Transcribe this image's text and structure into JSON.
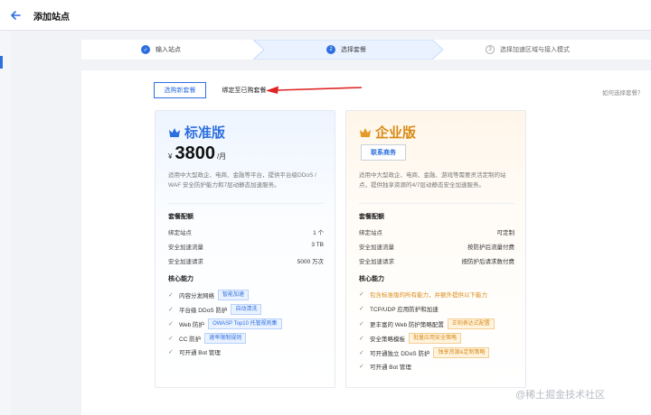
{
  "header": {
    "title": "添加站点"
  },
  "steps": [
    {
      "num": "✓",
      "label": "输入站点"
    },
    {
      "num": "2",
      "label": "选择套餐"
    },
    {
      "num": "3",
      "label": "选择加速区域与接入模式"
    }
  ],
  "tabs": {
    "new": "选购新套餐",
    "bind": "绑定至已购套餐"
  },
  "help_link": "如何选择套餐？",
  "plans": {
    "standard": {
      "name": "标准版",
      "currency": "¥",
      "price": "3800",
      "unit": "/月",
      "desc": "适用中大型政企、电商、金融等平台，提供平台级DDoS / WAF 安全防护能力和7层动静态加速服务。",
      "config_title": "套餐配额",
      "config": [
        {
          "k": "绑定站点",
          "v": "1 个"
        },
        {
          "k": "安全加速流量",
          "v": "3 TB"
        },
        {
          "k": "安全加速请求",
          "v": "5000 万次"
        }
      ],
      "cap_title": "核心能力",
      "caps": [
        {
          "text": "内容分发网络",
          "tag": "智能加速"
        },
        {
          "text": "平台级 DDoS 防护",
          "tag": "自动清洗"
        },
        {
          "text": "Web 防护",
          "tag": "OWASP Top10 托管规则集"
        },
        {
          "text": "CC 防护",
          "tag": "速率限制规则"
        },
        {
          "text": "可开通 Bot 管理",
          "tag": ""
        }
      ]
    },
    "enterprise": {
      "name": "企业版",
      "contact": "联系商务",
      "desc": "适用中大型政企、电商、金融、游戏等需要灵活定制的站点，提供独享资源的4/7层动静态安全加速服务。",
      "config_title": "套餐配额",
      "config": [
        {
          "k": "绑定站点",
          "v": "可定制"
        },
        {
          "k": "安全加速流量",
          "v": "按防护后流量付费"
        },
        {
          "k": "安全加速请求",
          "v": "按防护后请求数付费"
        }
      ],
      "cap_title": "核心能力",
      "caps": [
        {
          "text": "包含标准版的所有能力，并额外提供以下能力",
          "tag": ""
        },
        {
          "text": "TCP/UDP 应用防护和加速",
          "tag": ""
        },
        {
          "text": "更丰富的 Web 防护策略配置",
          "tag": "正则表达式配置"
        },
        {
          "text": "安全策略模板",
          "tag": "批量应用安全策略"
        },
        {
          "text": "可开通独立 DDoS 防护",
          "tag": "独享资源&定制策略"
        },
        {
          "text": "可开通 Bot 管理",
          "tag": ""
        }
      ]
    }
  },
  "watermark": "@稀土掘金技术社区",
  "colors": {
    "accent": "#2d6fdf",
    "enterprise": "#d98a15"
  }
}
